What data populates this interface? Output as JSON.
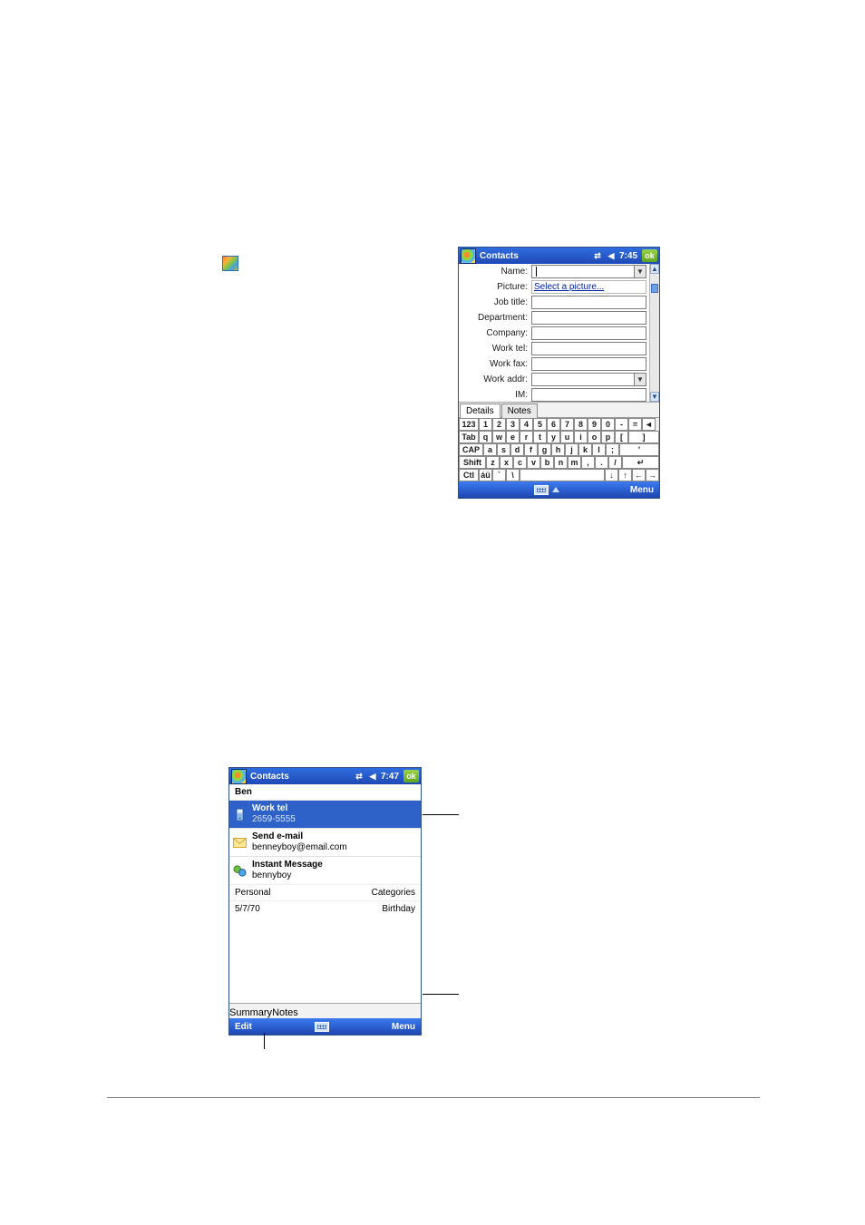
{
  "flag_icon_name": "start-flag-icon",
  "pda1": {
    "title": "Contacts",
    "time": "7:45",
    "ok": "ok",
    "form_labels": {
      "name": "Name:",
      "picture": "Picture:",
      "jobtitle": "Job title:",
      "department": "Department:",
      "company": "Company:",
      "worktel": "Work tel:",
      "workfax": "Work fax:",
      "workaddr": "Work addr:",
      "im": "IM:"
    },
    "picture_link": "Select a picture...",
    "tabs": {
      "details": "Details",
      "notes": "Notes"
    },
    "keyboard": {
      "row1_prefix": "123",
      "row1": [
        "1",
        "2",
        "3",
        "4",
        "5",
        "6",
        "7",
        "8",
        "9",
        "0",
        "-",
        "=",
        "◄"
      ],
      "row2_prefix": "Tab",
      "row2": [
        "q",
        "w",
        "e",
        "r",
        "t",
        "y",
        "u",
        "i",
        "o",
        "p",
        "[",
        "]"
      ],
      "row3_prefix": "CAP",
      "row3": [
        "a",
        "s",
        "d",
        "f",
        "g",
        "h",
        "j",
        "k",
        "l",
        ";",
        "'"
      ],
      "row4_prefix": "Shift",
      "row4": [
        "z",
        "x",
        "c",
        "v",
        "b",
        "n",
        "m",
        ",",
        ".",
        "/",
        "↵"
      ],
      "row5_prefix": "Ctl",
      "row5_au": "áü",
      "row5_keys": [
        "`",
        "\\"
      ],
      "row5_arrows": [
        "↓",
        "↑",
        "←",
        "→"
      ]
    },
    "bottombar": {
      "menu": "Menu"
    }
  },
  "pda2": {
    "title": "Contacts",
    "time": "7:47",
    "ok": "ok",
    "contact_name": "Ben",
    "items": [
      {
        "icon": "phone-icon",
        "title": "Work tel",
        "sub": "2659-5555",
        "selected": true
      },
      {
        "icon": "mail-icon",
        "title": "Send e-mail",
        "sub": "benneyboy@email.com",
        "selected": false
      },
      {
        "icon": "im-icon",
        "title": "Instant Message",
        "sub": "bennyboy",
        "selected": false
      }
    ],
    "meta": [
      {
        "left": "Personal",
        "right": "Categories"
      },
      {
        "left": "5/7/70",
        "right": "Birthday"
      }
    ],
    "tabs": {
      "summary": "Summary",
      "notes": "Notes"
    },
    "bottombar": {
      "edit": "Edit",
      "menu": "Menu"
    }
  }
}
